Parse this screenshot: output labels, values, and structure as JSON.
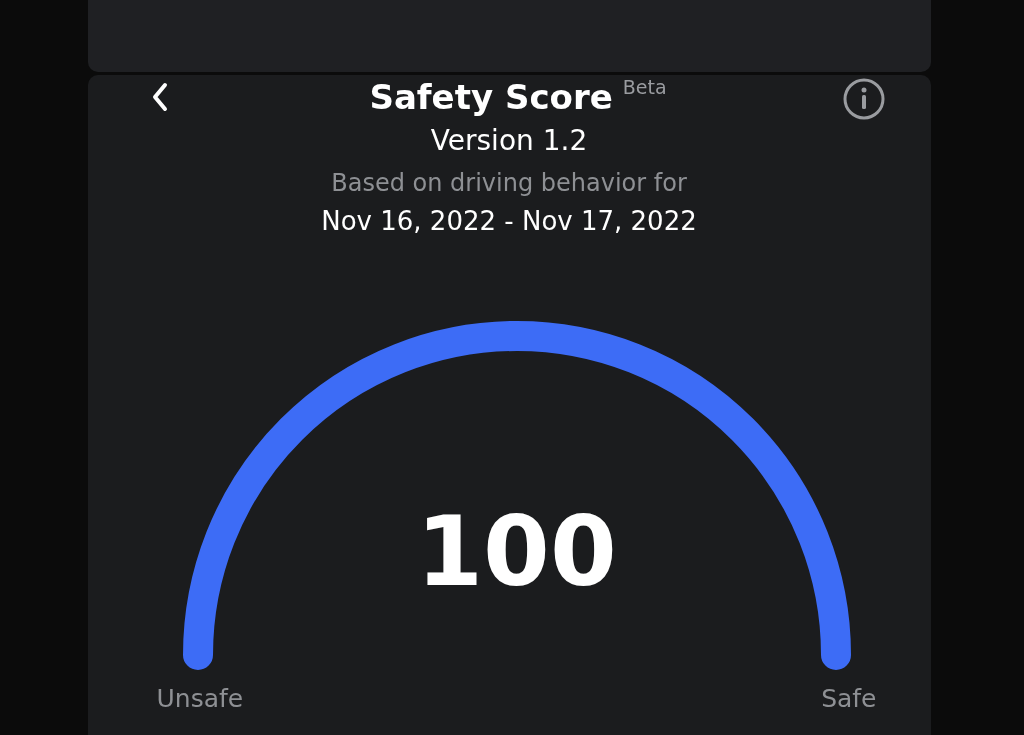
{
  "header": {
    "title": "Safety Score",
    "badge": "Beta",
    "version": "Version 1.2",
    "subtitle": "Based on driving behavior for",
    "date_range": "Nov 16, 2022 - Nov 17, 2022"
  },
  "gauge": {
    "score": "100",
    "min_label": "Unsafe",
    "max_label": "Safe"
  }
}
